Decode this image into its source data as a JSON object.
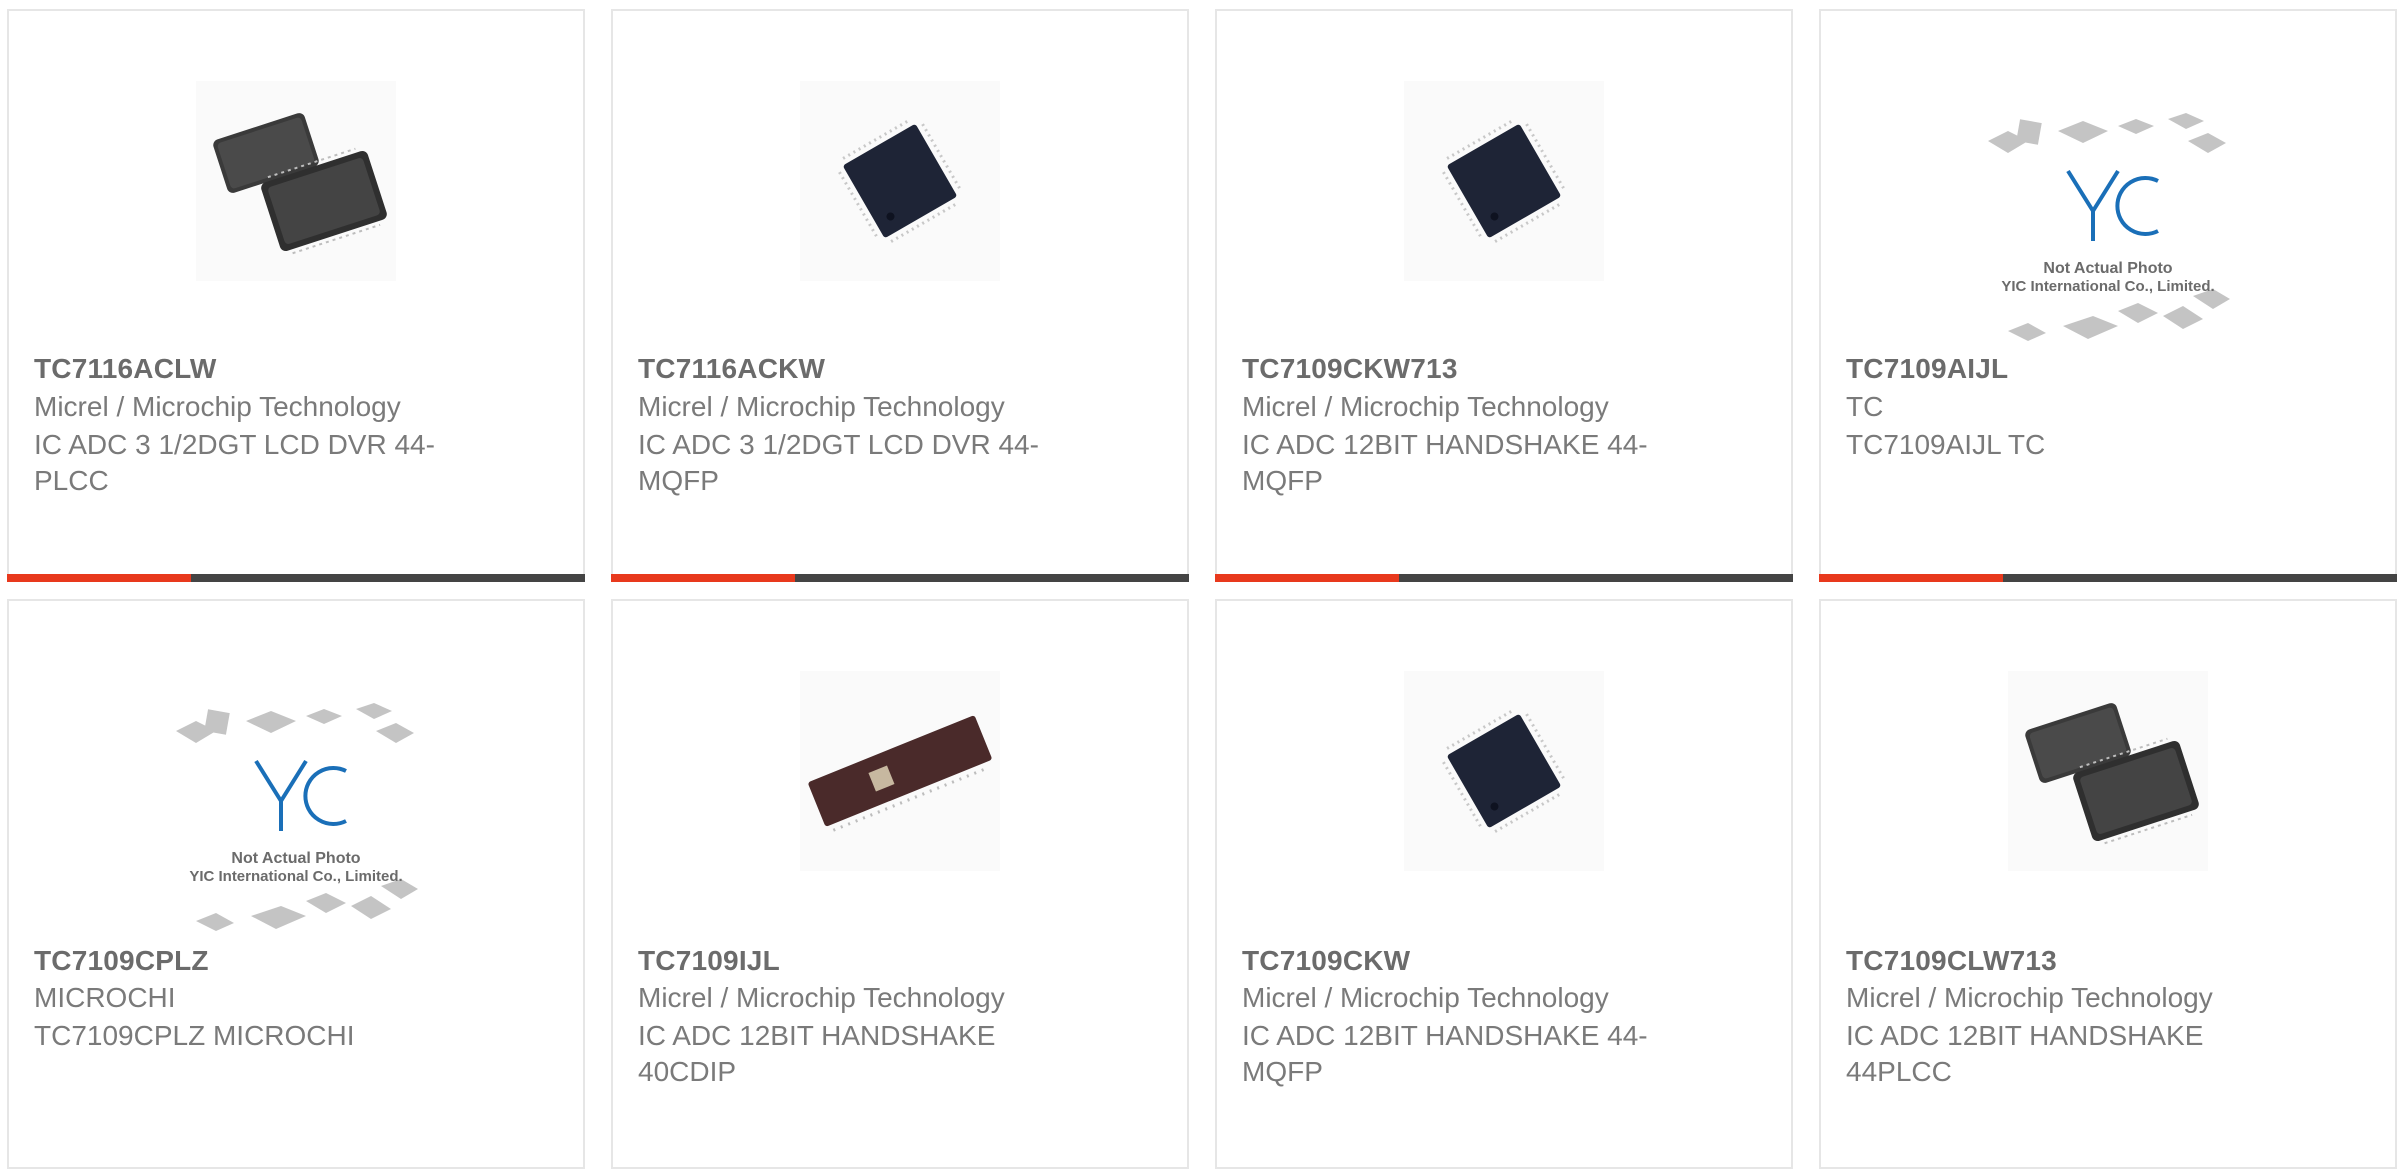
{
  "colors": {
    "accent": "#e8391d",
    "bar_dark": "#444444",
    "text": "#7a7a7a",
    "part_number": "#6b6b6b",
    "border": "#e6e6e6"
  },
  "products": [
    {
      "part_number": "TC7116ACLW",
      "manufacturer": "Micrel / Microchip Technology",
      "description": "IC ADC 3 1/2DGT LCD DVR 44-PLCC",
      "image": "plcc-chips-photo"
    },
    {
      "part_number": "TC7116ACKW",
      "manufacturer": "Micrel / Microchip Technology",
      "description": "IC ADC 3 1/2DGT LCD DVR 44-MQFP",
      "image": "mqfp-chip-photo"
    },
    {
      "part_number": "TC7109CKW713",
      "manufacturer": "Micrel / Microchip Technology",
      "description": "IC ADC 12BIT HANDSHAKE 44-MQFP",
      "image": "mqfp-chip-photo"
    },
    {
      "part_number": "TC7109AIJL",
      "manufacturer": "TC",
      "description": "TC7109AIJL TC",
      "image": "placeholder-not-actual-photo"
    },
    {
      "part_number": "TC7109CPLZ",
      "manufacturer": "MICROCHI",
      "description": "TC7109CPLZ MICROCHI",
      "image": "placeholder-not-actual-photo"
    },
    {
      "part_number": "TC7109IJL",
      "manufacturer": "Micrel / Microchip Technology",
      "description": "IC ADC 12BIT HANDSHAKE 40CDIP",
      "image": "cdip-chip-photo"
    },
    {
      "part_number": "TC7109CKW",
      "manufacturer": "Micrel / Microchip Technology",
      "description": "IC ADC 12BIT HANDSHAKE 44-MQFP",
      "image": "mqfp-chip-photo"
    },
    {
      "part_number": "TC7109CLW713",
      "manufacturer": "Micrel / Microchip Technology",
      "description": "IC ADC 12BIT HANDSHAKE 44PLCC",
      "image": "plcc-chips-photo"
    }
  ],
  "placeholder": {
    "logo_text": "YIC",
    "line1": "Not Actual Photo",
    "line2": "YIC International Co., Limited."
  }
}
